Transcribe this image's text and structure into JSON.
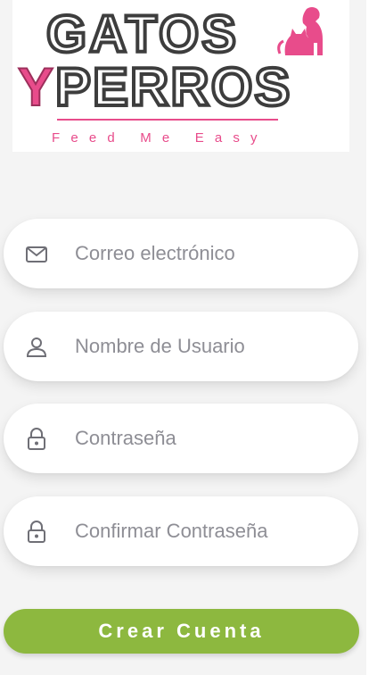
{
  "logo": {
    "line1": "GATOS",
    "line2": "PERROS",
    "initial": "Y",
    "tagline": "F e e d   M e   E a s y"
  },
  "form": {
    "email": {
      "placeholder": "Correo electrónico",
      "icon": "mail-icon"
    },
    "username": {
      "placeholder": "Nombre de Usuario",
      "icon": "user-icon"
    },
    "password": {
      "placeholder": "Contraseña",
      "icon": "lock-icon"
    },
    "confirm_password": {
      "placeholder": "Confirmar Contraseña",
      "icon": "lock-icon"
    }
  },
  "submit_label": "Crear Cuenta",
  "colors": {
    "accent_green": "#8db83f",
    "brand_pink": "#e84c8b",
    "logo_gray": "#555555"
  }
}
